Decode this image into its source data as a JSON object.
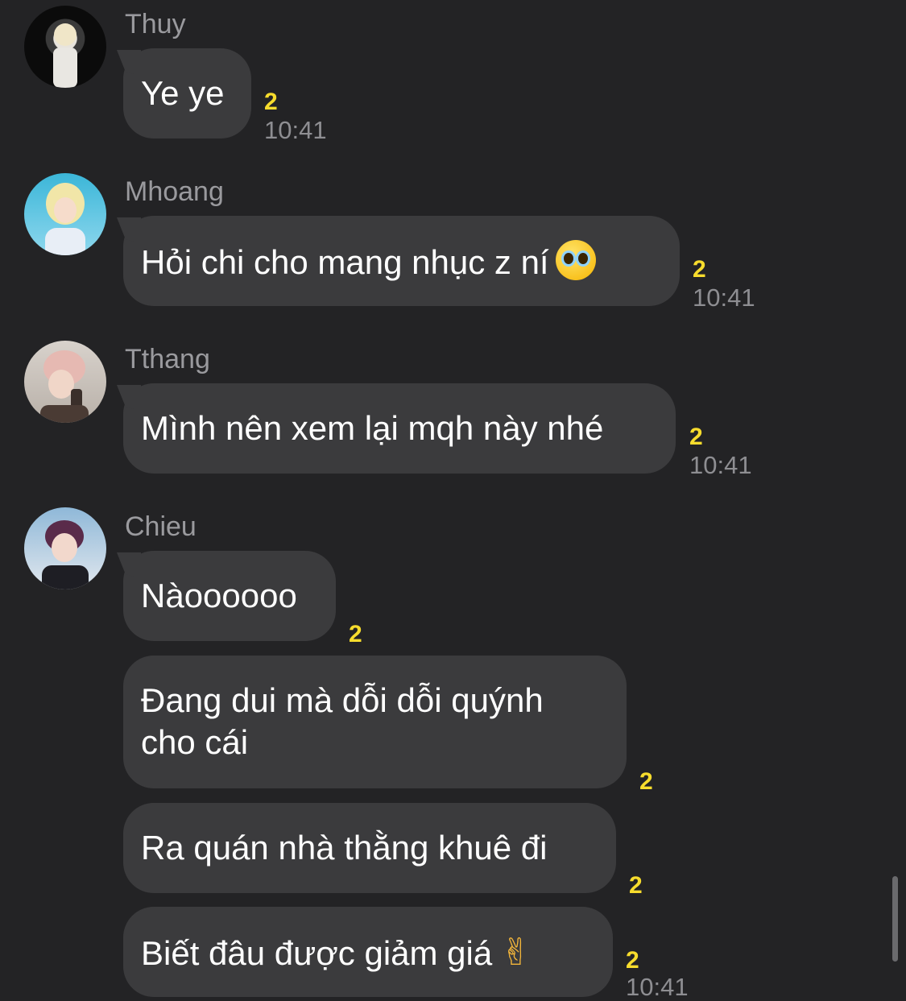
{
  "messages": [
    {
      "sender": "Thuy",
      "text": "Ye ye",
      "count": "2",
      "time": "10:41"
    },
    {
      "sender": "Mhoang",
      "text": "Hỏi chi cho mang nhục z ní",
      "emoji": "pleading-face-emoji",
      "count": "2",
      "time": "10:41"
    },
    {
      "sender": "Tthang",
      "text": "Mình nên xem lại mqh này nhé",
      "count": "2",
      "time": "10:41"
    },
    {
      "sender": "Chieu",
      "text": "Nàoooooo",
      "count": "2"
    },
    {
      "text_line1": "Đang dui mà dỗi dỗi quýnh",
      "text_line2": "cho cái",
      "count": "2"
    },
    {
      "text": "Ra quán nhà thằng khuê đi",
      "count": "2"
    },
    {
      "text": "Biết đâu được giảm giá",
      "emoji": "crossed-fingers-emoji",
      "count": "2",
      "time": "10:41"
    }
  ],
  "colors": {
    "background": "#232325",
    "bubble": "#3b3b3d",
    "count": "#f7dc2d",
    "sender": "#9a9a9e",
    "time": "#8e8e92"
  }
}
